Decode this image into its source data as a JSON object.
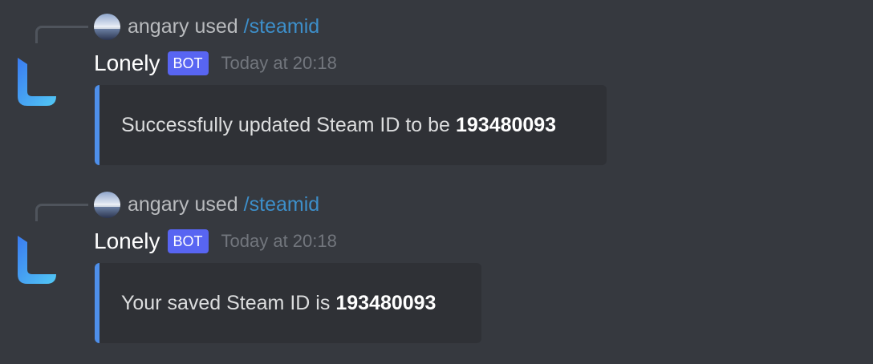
{
  "messages": [
    {
      "reply": {
        "user": "angary",
        "used": "used",
        "command": "/steamid"
      },
      "author": {
        "name": "Lonely",
        "badge": "BOT",
        "timestamp": "Today at 20:18"
      },
      "embed": {
        "text": "Successfully updated Steam ID to be",
        "value": "193480093"
      }
    },
    {
      "reply": {
        "user": "angary",
        "used": "used",
        "command": "/steamid"
      },
      "author": {
        "name": "Lonely",
        "badge": "BOT",
        "timestamp": "Today at 20:18"
      },
      "embed": {
        "text": "Your saved Steam ID is",
        "value": "193480093"
      }
    }
  ],
  "colors": {
    "background": "#36393f",
    "embed_background": "#2f3136",
    "embed_accent": "#4e8fea",
    "bot_badge": "#5865f2",
    "command_link": "#3d8fca"
  }
}
